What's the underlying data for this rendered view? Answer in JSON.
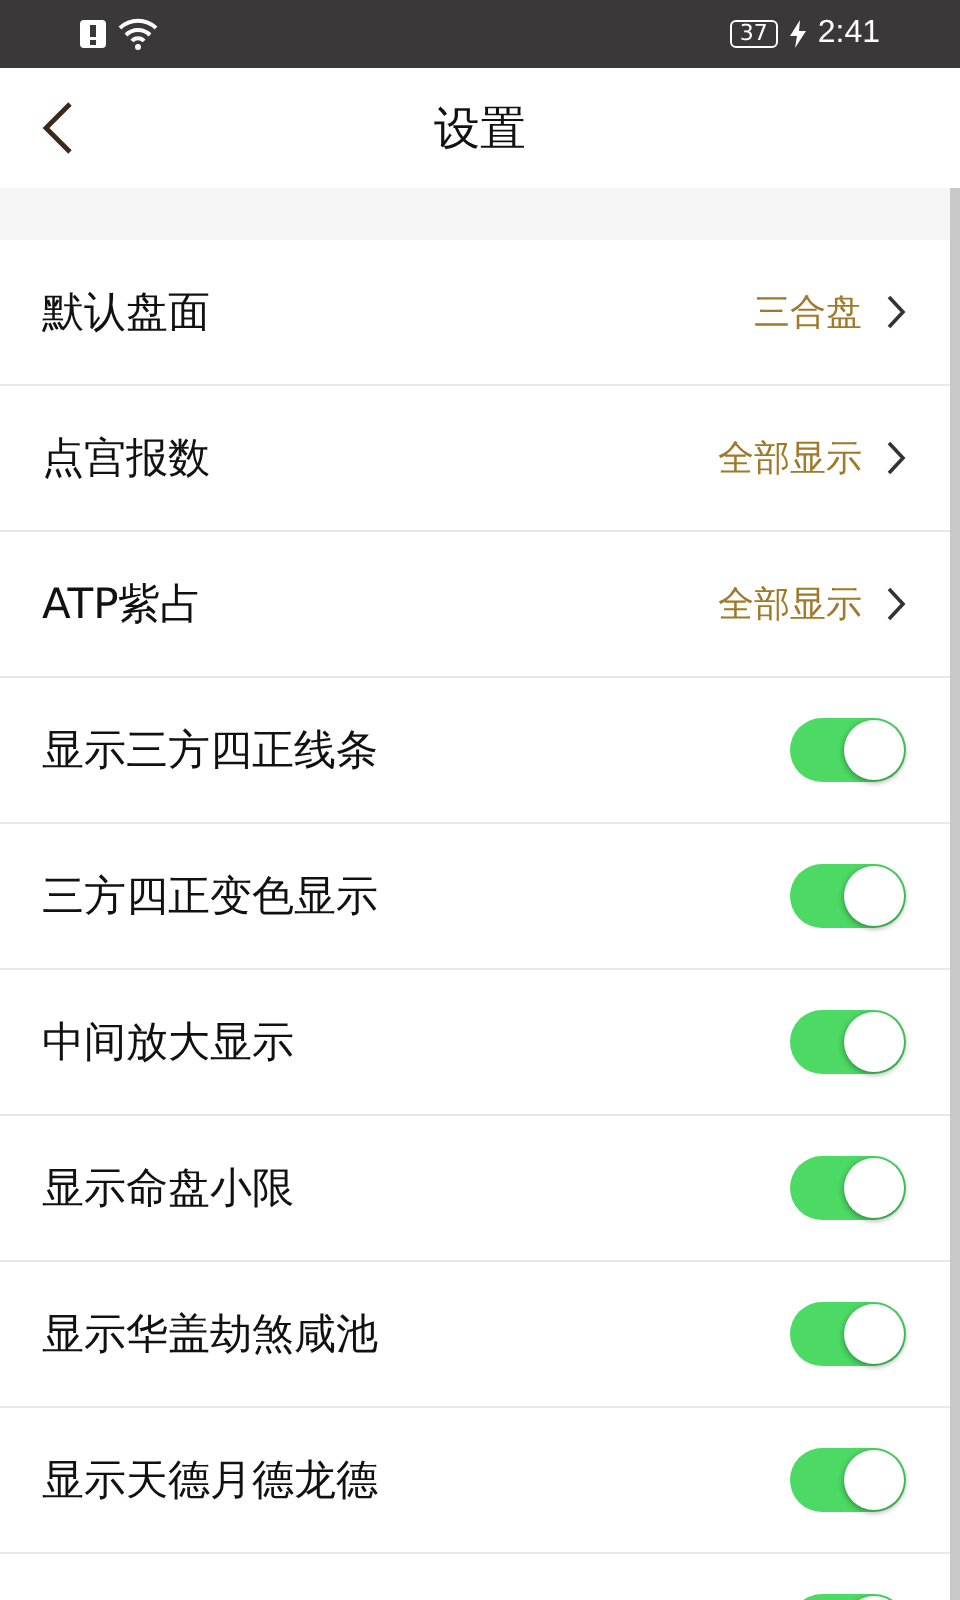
{
  "status_bar": {
    "battery": "37",
    "time": "2:41"
  },
  "header": {
    "title": "设置"
  },
  "settings": [
    {
      "kind": "select",
      "label": "默认盘面",
      "value": "三合盘"
    },
    {
      "kind": "select",
      "label": "点宫报数",
      "value": "全部显示"
    },
    {
      "kind": "select",
      "label": "ATP紫占",
      "value": "全部显示"
    },
    {
      "kind": "toggle",
      "label": "显示三方四正线条",
      "on": true
    },
    {
      "kind": "toggle",
      "label": "三方四正变色显示",
      "on": true
    },
    {
      "kind": "toggle",
      "label": "中间放大显示",
      "on": true
    },
    {
      "kind": "toggle",
      "label": "显示命盘小限",
      "on": true
    },
    {
      "kind": "toggle",
      "label": "显示华盖劫煞咸池",
      "on": true
    },
    {
      "kind": "toggle",
      "label": "显示天德月德龙德",
      "on": true
    },
    {
      "kind": "toggle",
      "on": true
    }
  ]
}
